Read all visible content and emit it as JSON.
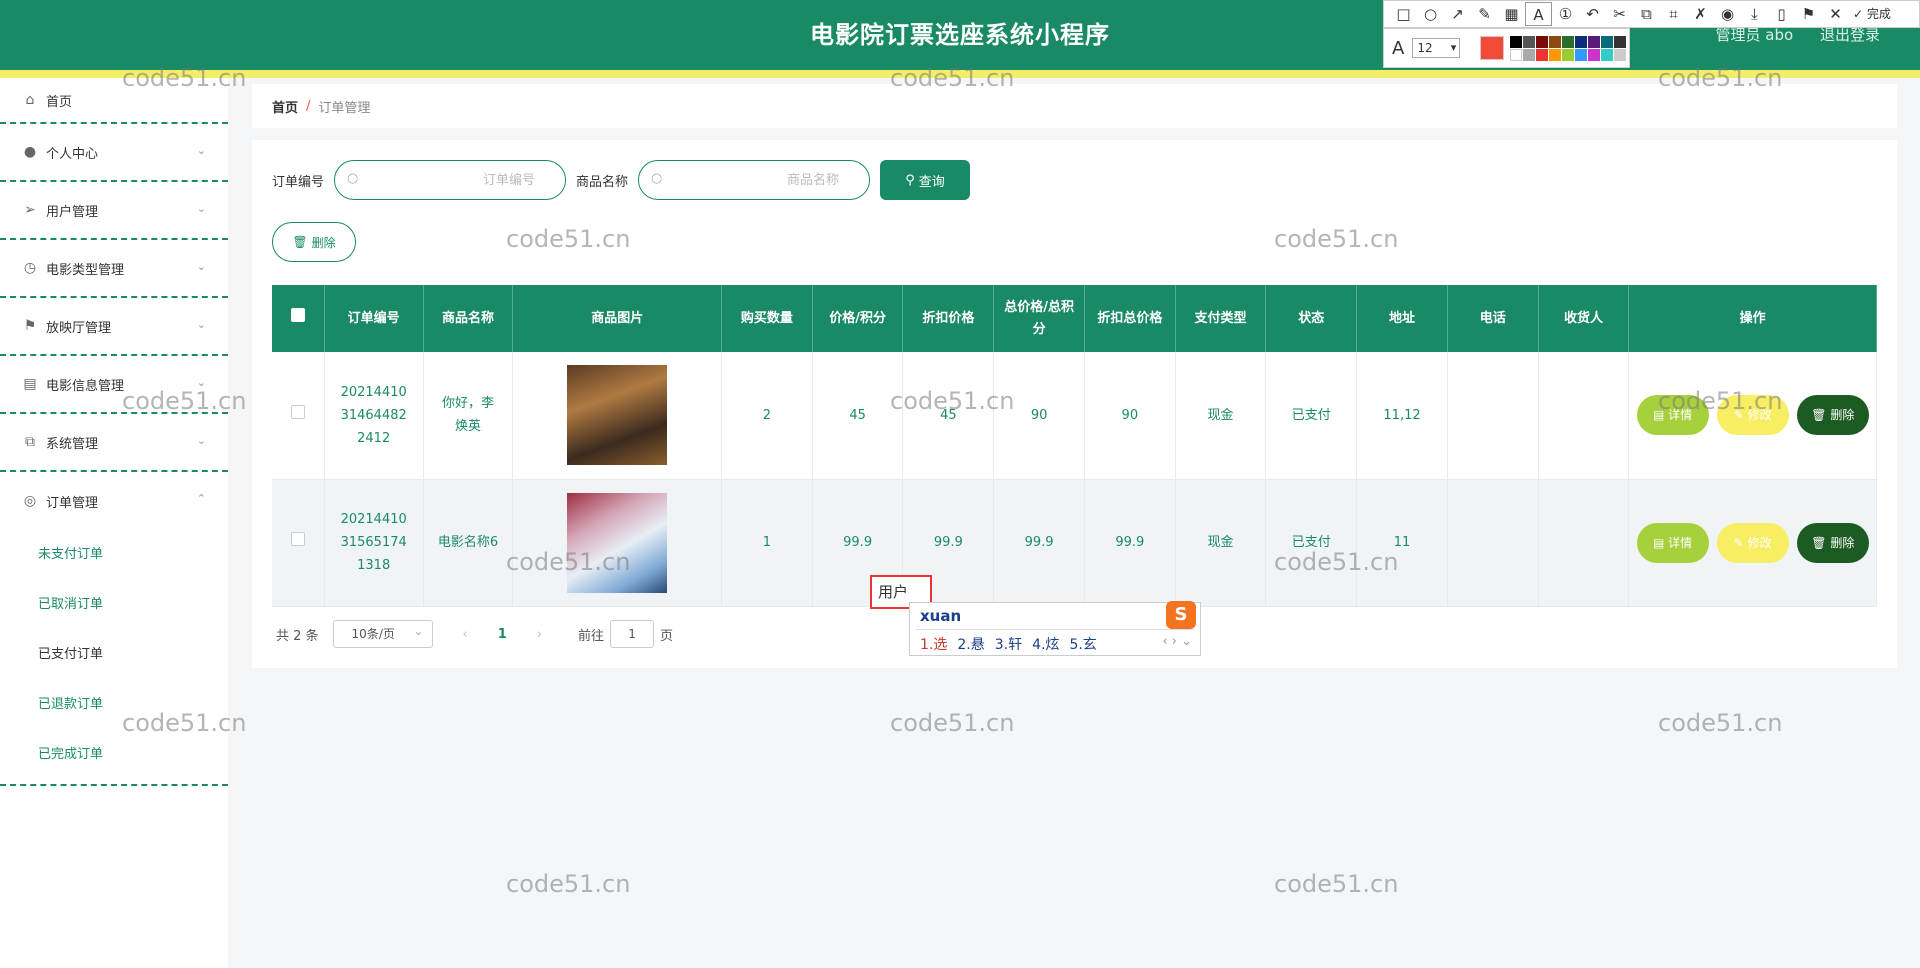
{
  "header": {
    "title": "电影院订票选座系统小程序",
    "user_label": "管理员 abo",
    "logout_label": "退出登录",
    "accent_color": "#1a8a66",
    "stripe_color": "#f3ee6a"
  },
  "snip": {
    "font_size": "12",
    "done_label": "完成",
    "icons": [
      "rect-icon",
      "ellipse-icon",
      "arrow-icon",
      "pen-icon",
      "mosaic-icon",
      "text-icon",
      "step-icon",
      "undo-icon",
      "cut-icon",
      "copy-icon",
      "ocr-icon",
      "translate-icon",
      "record-icon",
      "download-icon",
      "phone-icon",
      "pin-icon",
      "close-icon"
    ]
  },
  "sidebar": {
    "items": [
      {
        "label": "首页",
        "icon": "home-icon"
      },
      {
        "label": "个人中心",
        "icon": "user-icon"
      },
      {
        "label": "用户管理",
        "icon": "send-icon"
      },
      {
        "label": "电影类型管理",
        "icon": "clock-icon"
      },
      {
        "label": "放映厅管理",
        "icon": "flag-icon"
      },
      {
        "label": "电影信息管理",
        "icon": "clipboard-icon"
      },
      {
        "label": "系统管理",
        "icon": "copy-icon"
      },
      {
        "label": "订单管理",
        "icon": "target-icon"
      }
    ],
    "order_sub": [
      "未支付订单",
      "已取消订单",
      "已支付订单",
      "已退款订单",
      "已完成订单"
    ]
  },
  "breadcrumb": {
    "home": "首页",
    "sep": "/",
    "current": "订单管理"
  },
  "search": {
    "order_label": "订单编号",
    "order_placeholder": "订单编号",
    "goods_label": "商品名称",
    "goods_placeholder": "商品名称",
    "query_label": "查询"
  },
  "batch_delete_label": "删除",
  "table": {
    "headers": [
      "订单编号",
      "商品名称",
      "商品图片",
      "购买数量",
      "价格/积分",
      "折扣价格",
      "总价格/总积分",
      "折扣总价格",
      "支付类型",
      "状态",
      "地址",
      "电话",
      "收货人",
      "操作"
    ],
    "rows": [
      {
        "order_no": "20214410314644822412",
        "order_no_lines": [
          "20214410",
          "31464482",
          "2412"
        ],
        "goods": "你好，李焕英",
        "goods_lines": [
          "你好，李",
          "焕英"
        ],
        "qty": "2",
        "price": "45",
        "discount_price": "45",
        "total": "90",
        "discount_total": "90",
        "pay_type": "现金",
        "status": "已支付",
        "address": "11,12",
        "phone": "",
        "receiver": ""
      },
      {
        "order_no": "20214410315651741318",
        "order_no_lines": [
          "20214410",
          "31565174",
          "1318"
        ],
        "goods": "电影名称6",
        "goods_lines": [
          "电影名称6"
        ],
        "qty": "1",
        "price": "99.9",
        "discount_price": "99.9",
        "total": "99.9",
        "discount_total": "99.9",
        "pay_type": "现金",
        "status": "已支付",
        "address": "11",
        "phone": "",
        "receiver": ""
      }
    ],
    "ops": {
      "detail": "详情",
      "edit": "修改",
      "delete": "删除"
    }
  },
  "pager": {
    "total": "共 2 条",
    "page_size": "10条/页",
    "current": "1",
    "goto_label": "前往",
    "goto_value": "1",
    "page_unit": "页"
  },
  "watermark": "code51.cn",
  "ime": {
    "input_text": "用户",
    "pinyin": "xuan",
    "candidates": [
      "1.选",
      "2.悬",
      "3.轩",
      "4.炫",
      "5.玄"
    ],
    "logo": "S"
  }
}
